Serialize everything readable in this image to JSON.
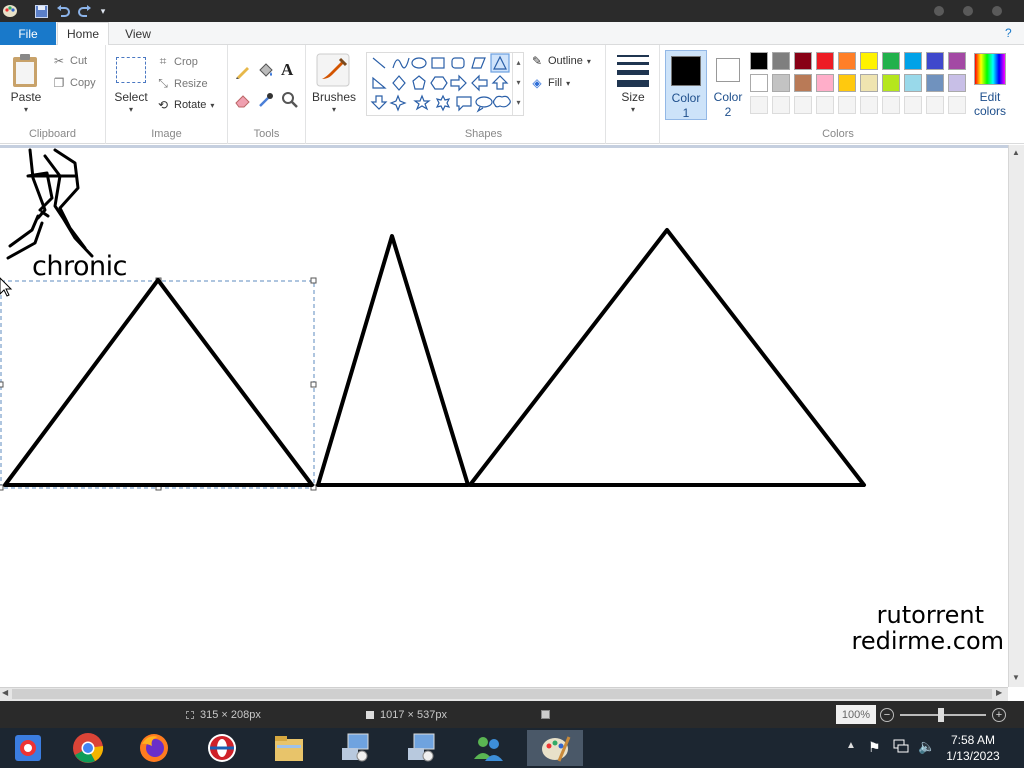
{
  "tabs": {
    "file": "File",
    "home": "Home",
    "view": "View"
  },
  "clipboard": {
    "paste": "Paste",
    "cut": "Cut",
    "copy": "Copy",
    "label": "Clipboard"
  },
  "image": {
    "select": "Select",
    "crop": "Crop",
    "resize": "Resize",
    "rotate": "Rotate",
    "label": "Image"
  },
  "tools": {
    "text_tool": "A",
    "label": "Tools"
  },
  "brushes": {
    "label": "Brushes"
  },
  "shapes": {
    "outline": "Outline",
    "fill": "Fill",
    "label": "Shapes"
  },
  "size": {
    "label": "Size"
  },
  "colors": {
    "color1_label": "Color",
    "color1_num": "1",
    "color2_label": "Color",
    "color2_num": "2",
    "edit_label": "Edit",
    "edit_label2": "colors",
    "label": "Colors",
    "color1_value": "#000000",
    "color2_value": "#ffffff",
    "palette_row1": [
      "#000000",
      "#7f7f7f",
      "#880015",
      "#ed1c24",
      "#ff7f27",
      "#fff200",
      "#22b14c",
      "#00a2e8",
      "#3f48cc",
      "#a349a4"
    ],
    "palette_row2": [
      "#ffffff",
      "#c3c3c3",
      "#b97a57",
      "#ffaec9",
      "#ffc90e",
      "#efe4b0",
      "#b5e61d",
      "#99d9ea",
      "#7092be",
      "#c8bfe7"
    ]
  },
  "canvas": {
    "text_chronic": "chronic",
    "watermark_line1": "rutorrent",
    "watermark_line2": "redirme.com"
  },
  "status": {
    "selection_size": "315 × 208px",
    "canvas_size": "1017 × 537px",
    "zoom": "100%"
  },
  "taskbar": {
    "apps": [
      "chrome-remote-icon",
      "chrome-icon",
      "firefox-icon",
      "opera-icon",
      "file-explorer-icon",
      "network-setup-icon",
      "network-setup-icon-2",
      "people-icon",
      "paint-icon"
    ],
    "time": "7:58 AM",
    "date": "1/13/2023"
  }
}
